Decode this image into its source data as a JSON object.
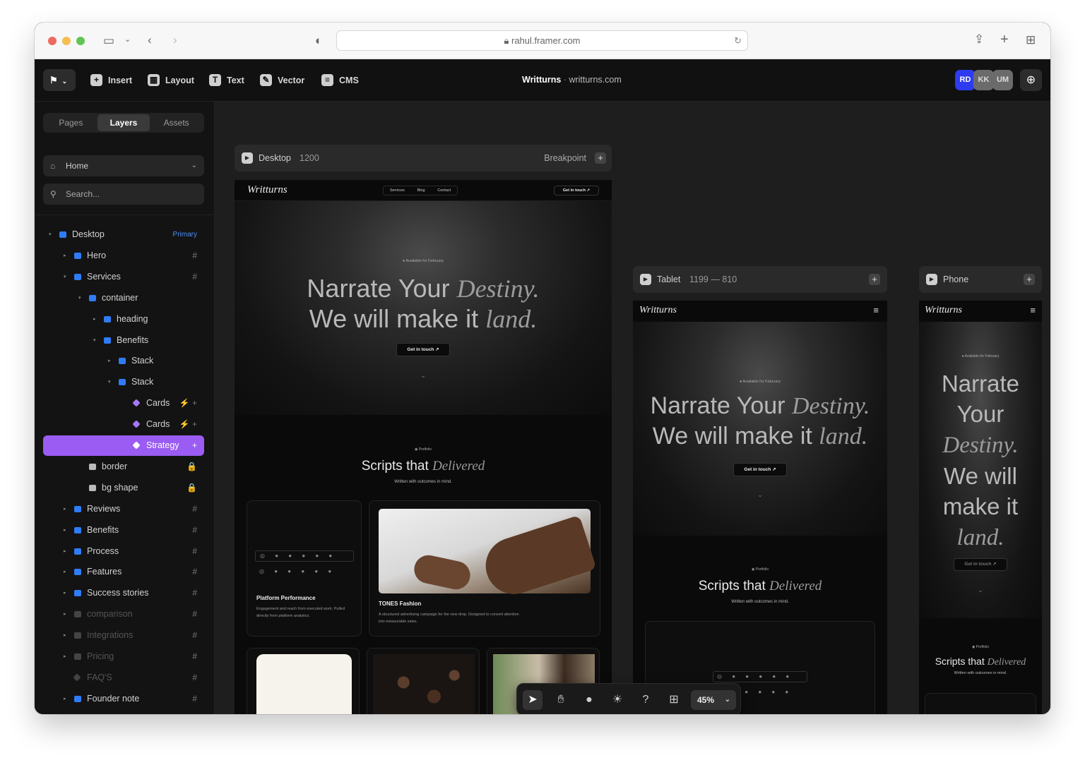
{
  "browser": {
    "url": "rahul.framer.com"
  },
  "toolbar": {
    "insert": "Insert",
    "layout": "Layout",
    "text": "Text",
    "vector": "Vector",
    "cms": "CMS",
    "project_name": "Writturns",
    "project_domain": "writturns.com",
    "avatars": [
      {
        "initials": "RD",
        "color": "#2d3cf0"
      },
      {
        "initials": "KK",
        "color": "#6b6b6b"
      },
      {
        "initials": "UM",
        "color": "#6b6b6b"
      }
    ]
  },
  "sidebar": {
    "tabs": [
      "Pages",
      "Layers",
      "Assets"
    ],
    "active_tab": "Layers",
    "page_select": "Home",
    "search_placeholder": "Search...",
    "layers": [
      {
        "name": "Desktop",
        "badge": "Primary"
      },
      {
        "name": "Hero",
        "badge": "#"
      },
      {
        "name": "Services",
        "badge": "#"
      },
      {
        "name": "container",
        "badge": ""
      },
      {
        "name": "heading",
        "badge": ""
      },
      {
        "name": "Benefits",
        "badge": ""
      },
      {
        "name": "Stack",
        "badge": ""
      },
      {
        "name": "Stack",
        "badge": ""
      },
      {
        "name": "Cards",
        "badge": "⚡ +"
      },
      {
        "name": "Cards",
        "badge": "⚡ +"
      },
      {
        "name": "Strategy",
        "badge": "+"
      },
      {
        "name": "border",
        "badge": "🔒"
      },
      {
        "name": "bg shape",
        "badge": "🔒"
      },
      {
        "name": "Reviews",
        "badge": "#"
      },
      {
        "name": "Benefits",
        "badge": "#"
      },
      {
        "name": "Process",
        "badge": "#"
      },
      {
        "name": "Features",
        "badge": "#"
      },
      {
        "name": "Success stories",
        "badge": "#"
      },
      {
        "name": "comparison",
        "badge": "#"
      },
      {
        "name": "Integrations",
        "badge": "#"
      },
      {
        "name": "Pricing",
        "badge": "#"
      },
      {
        "name": "FAQ'S",
        "badge": "#"
      },
      {
        "name": "Founder note",
        "badge": "#"
      }
    ]
  },
  "canvas": {
    "desktop": {
      "label": "Desktop",
      "width": "1200",
      "breakpoint": "Breakpoint"
    },
    "tablet": {
      "label": "Tablet",
      "range": "1199 — 810"
    },
    "phone": {
      "label": "Phone"
    },
    "site": {
      "logo": "Writturns",
      "nav": [
        "Services",
        "Blog",
        "Contact"
      ],
      "cta": "Get in touch ↗",
      "tag": "Available for February",
      "headline_1": "Narrate Your",
      "headline_1_italic": "Destiny.",
      "headline_2": "We will make it",
      "headline_2_italic": "land.",
      "portfolio_tag": "Portfolio",
      "section_title": "Scripts that",
      "section_title_italic": "Delivered",
      "section_sub": "Written with outcomes in mind.",
      "card1_title": "Platform Performance",
      "card1_text": "Engagement and reach from executed work. Pulled directly from platform analytics.",
      "card2_title": "TONES Fashion",
      "card2_text": "A structured advertising campaign for the new drop. Designed to convert attention into measurable sales.",
      "phone_headline": [
        "Narrate",
        "Your"
      ],
      "phone_headline_italic": "Destiny.",
      "phone_headline_2": [
        "We will",
        "make it"
      ],
      "phone_headline_2_italic": "land."
    }
  },
  "bottom": {
    "zoom": "45%"
  }
}
